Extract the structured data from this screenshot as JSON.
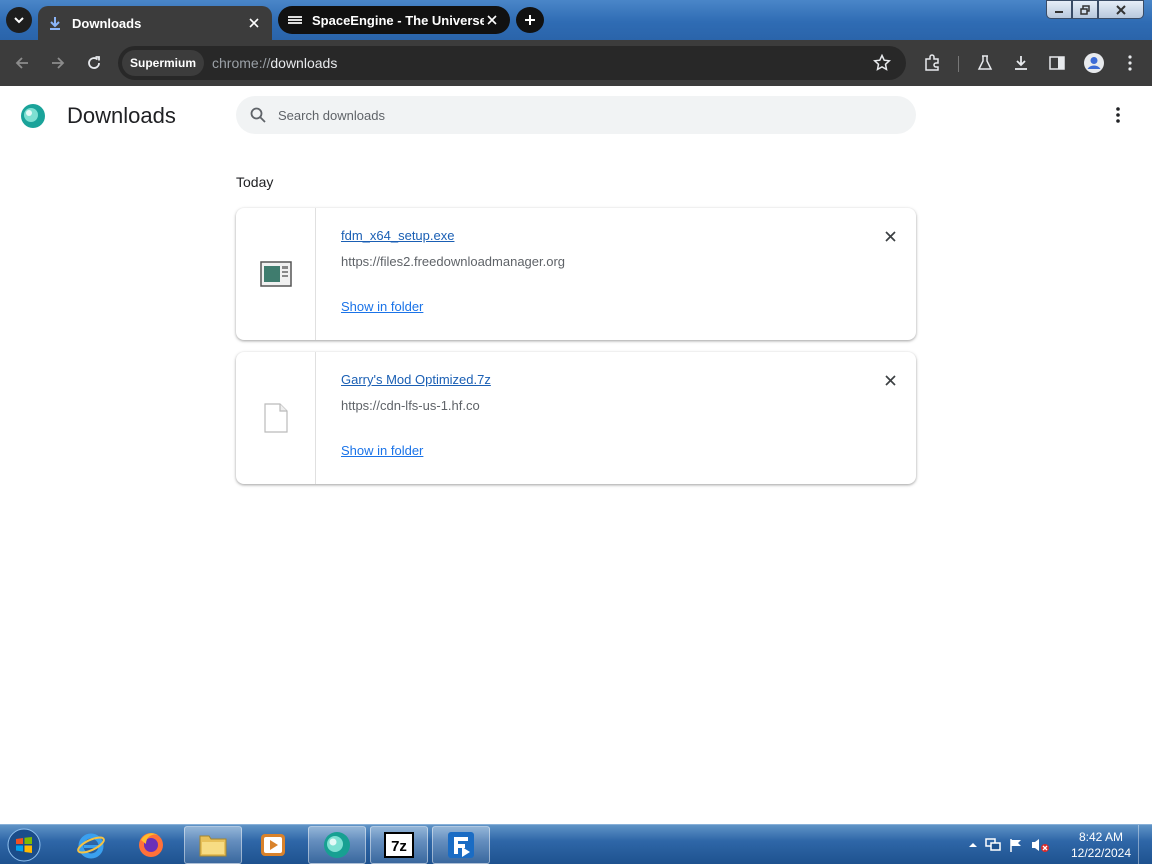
{
  "tabs": [
    {
      "title": "Downloads",
      "active": true
    },
    {
      "title": "SpaceEngine - The Universe Si",
      "active": false
    }
  ],
  "toolbar": {
    "chip": "Supermium",
    "url_scheme": "chrome://",
    "url_path": "downloads"
  },
  "page": {
    "title": "Downloads",
    "search_placeholder": "Search downloads",
    "section": "Today"
  },
  "downloads": [
    {
      "filename": "fdm_x64_setup.exe",
      "url": "https://files2.freedownloadmanager.org",
      "action": "Show in folder",
      "icon": "exe-file-icon"
    },
    {
      "filename": "Garry's Mod Optimized.7z",
      "url": "https://cdn-lfs-us-1.hf.co",
      "action": "Show in folder",
      "icon": "generic-file-icon"
    }
  ],
  "taskbar": {
    "time": "8:42 AM",
    "date": "12/22/2024",
    "apps": [
      "internet-explorer",
      "firefox",
      "file-explorer",
      "media-player",
      "supermium",
      "7-zip",
      "free-download-manager"
    ]
  },
  "colors": {
    "link": "#1a73e8",
    "toolbar": "#3c3c3c",
    "omnibox": "#282828"
  }
}
